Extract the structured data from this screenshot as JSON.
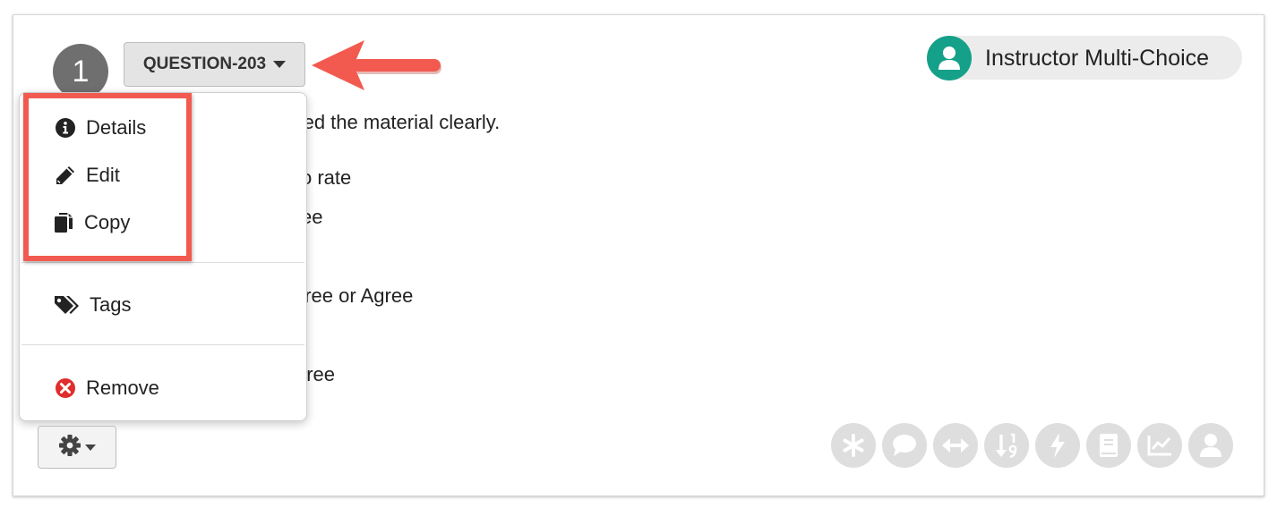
{
  "question": {
    "number": "1",
    "id_label": "QUESTION-203",
    "type_label": "Instructor Multi-Choice",
    "text_fragment": "ented the material clearly.",
    "option_fragments": [
      "o rate",
      "ee",
      "gree or Agree",
      "gree"
    ]
  },
  "dropdown": {
    "items": [
      {
        "label": "Details",
        "icon": "info-circle-icon"
      },
      {
        "label": "Edit",
        "icon": "pencil-icon"
      },
      {
        "label": "Copy",
        "icon": "copy-icon"
      },
      {
        "label": "Tags",
        "icon": "tags-icon"
      },
      {
        "label": "Remove",
        "icon": "remove-circle-icon"
      }
    ]
  },
  "toolbar_icons": [
    "asterisk-icon",
    "comment-icon",
    "arrows-horizontal-icon",
    "sort-numeric-icon",
    "bolt-icon",
    "book-icon",
    "chart-line-icon",
    "user-icon"
  ],
  "colors": {
    "highlight": "#f25a4f",
    "type_avatar": "#15a08a",
    "remove_icon": "#e02d2d",
    "number_badge": "#6f6f6f"
  }
}
